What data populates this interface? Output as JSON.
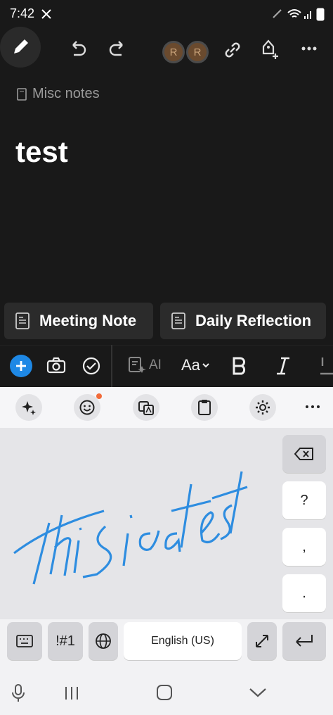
{
  "status": {
    "time": "7:42"
  },
  "note": {
    "breadcrumb": "Misc notes",
    "title": "test"
  },
  "avatars": [
    "R",
    "R"
  ],
  "templates": [
    "Meeting Note",
    "Daily Reflection"
  ],
  "toolbar": {
    "ai_label": "AI",
    "font_label": "Aa"
  },
  "keyboard": {
    "handwriting": "This is a test",
    "keys": {
      "question": "?",
      "comma": ",",
      "period": ".",
      "symbols": "!#1",
      "space": "English (US)"
    }
  },
  "colors": {
    "accent": "#1e88e5",
    "ink": "#2e8de0",
    "dot": "#f26b3a"
  }
}
